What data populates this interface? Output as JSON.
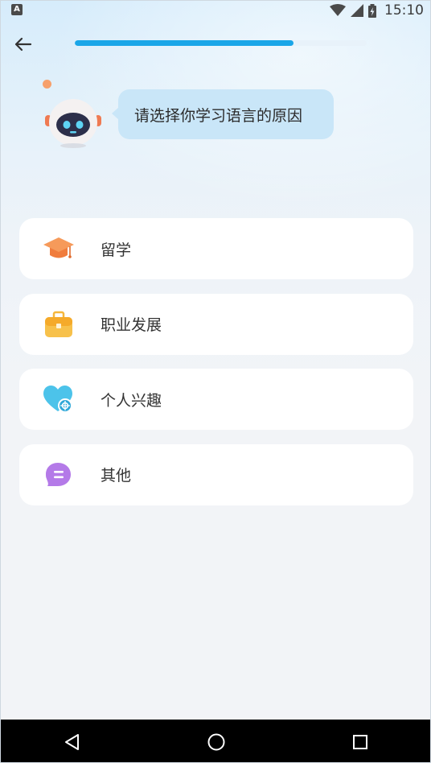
{
  "status_bar": {
    "app_icon_letter": "A",
    "time": "15:10",
    "icons": [
      "wifi-icon",
      "cell-signal-icon",
      "battery-charging-icon"
    ]
  },
  "header": {
    "back_icon": "arrow-left-icon",
    "progress_fraction": 0.75,
    "progress_color": "#1aa6e8"
  },
  "prompt": {
    "mascot": "robot-mascot",
    "text": "请选择你学习语言的原因"
  },
  "options": [
    {
      "label": "留学",
      "icon": "graduation-cap-icon",
      "color": "#f07c3c"
    },
    {
      "label": "职业发展",
      "icon": "briefcase-icon",
      "color": "#f5b73c"
    },
    {
      "label": "个人兴趣",
      "icon": "heart-icon",
      "color": "#4cc3ea"
    },
    {
      "label": "其他",
      "icon": "chat-icon",
      "color": "#b47ae8"
    }
  ],
  "nav_bar": {
    "icons": [
      "back-triangle-icon",
      "home-circle-icon",
      "recents-square-icon"
    ]
  }
}
